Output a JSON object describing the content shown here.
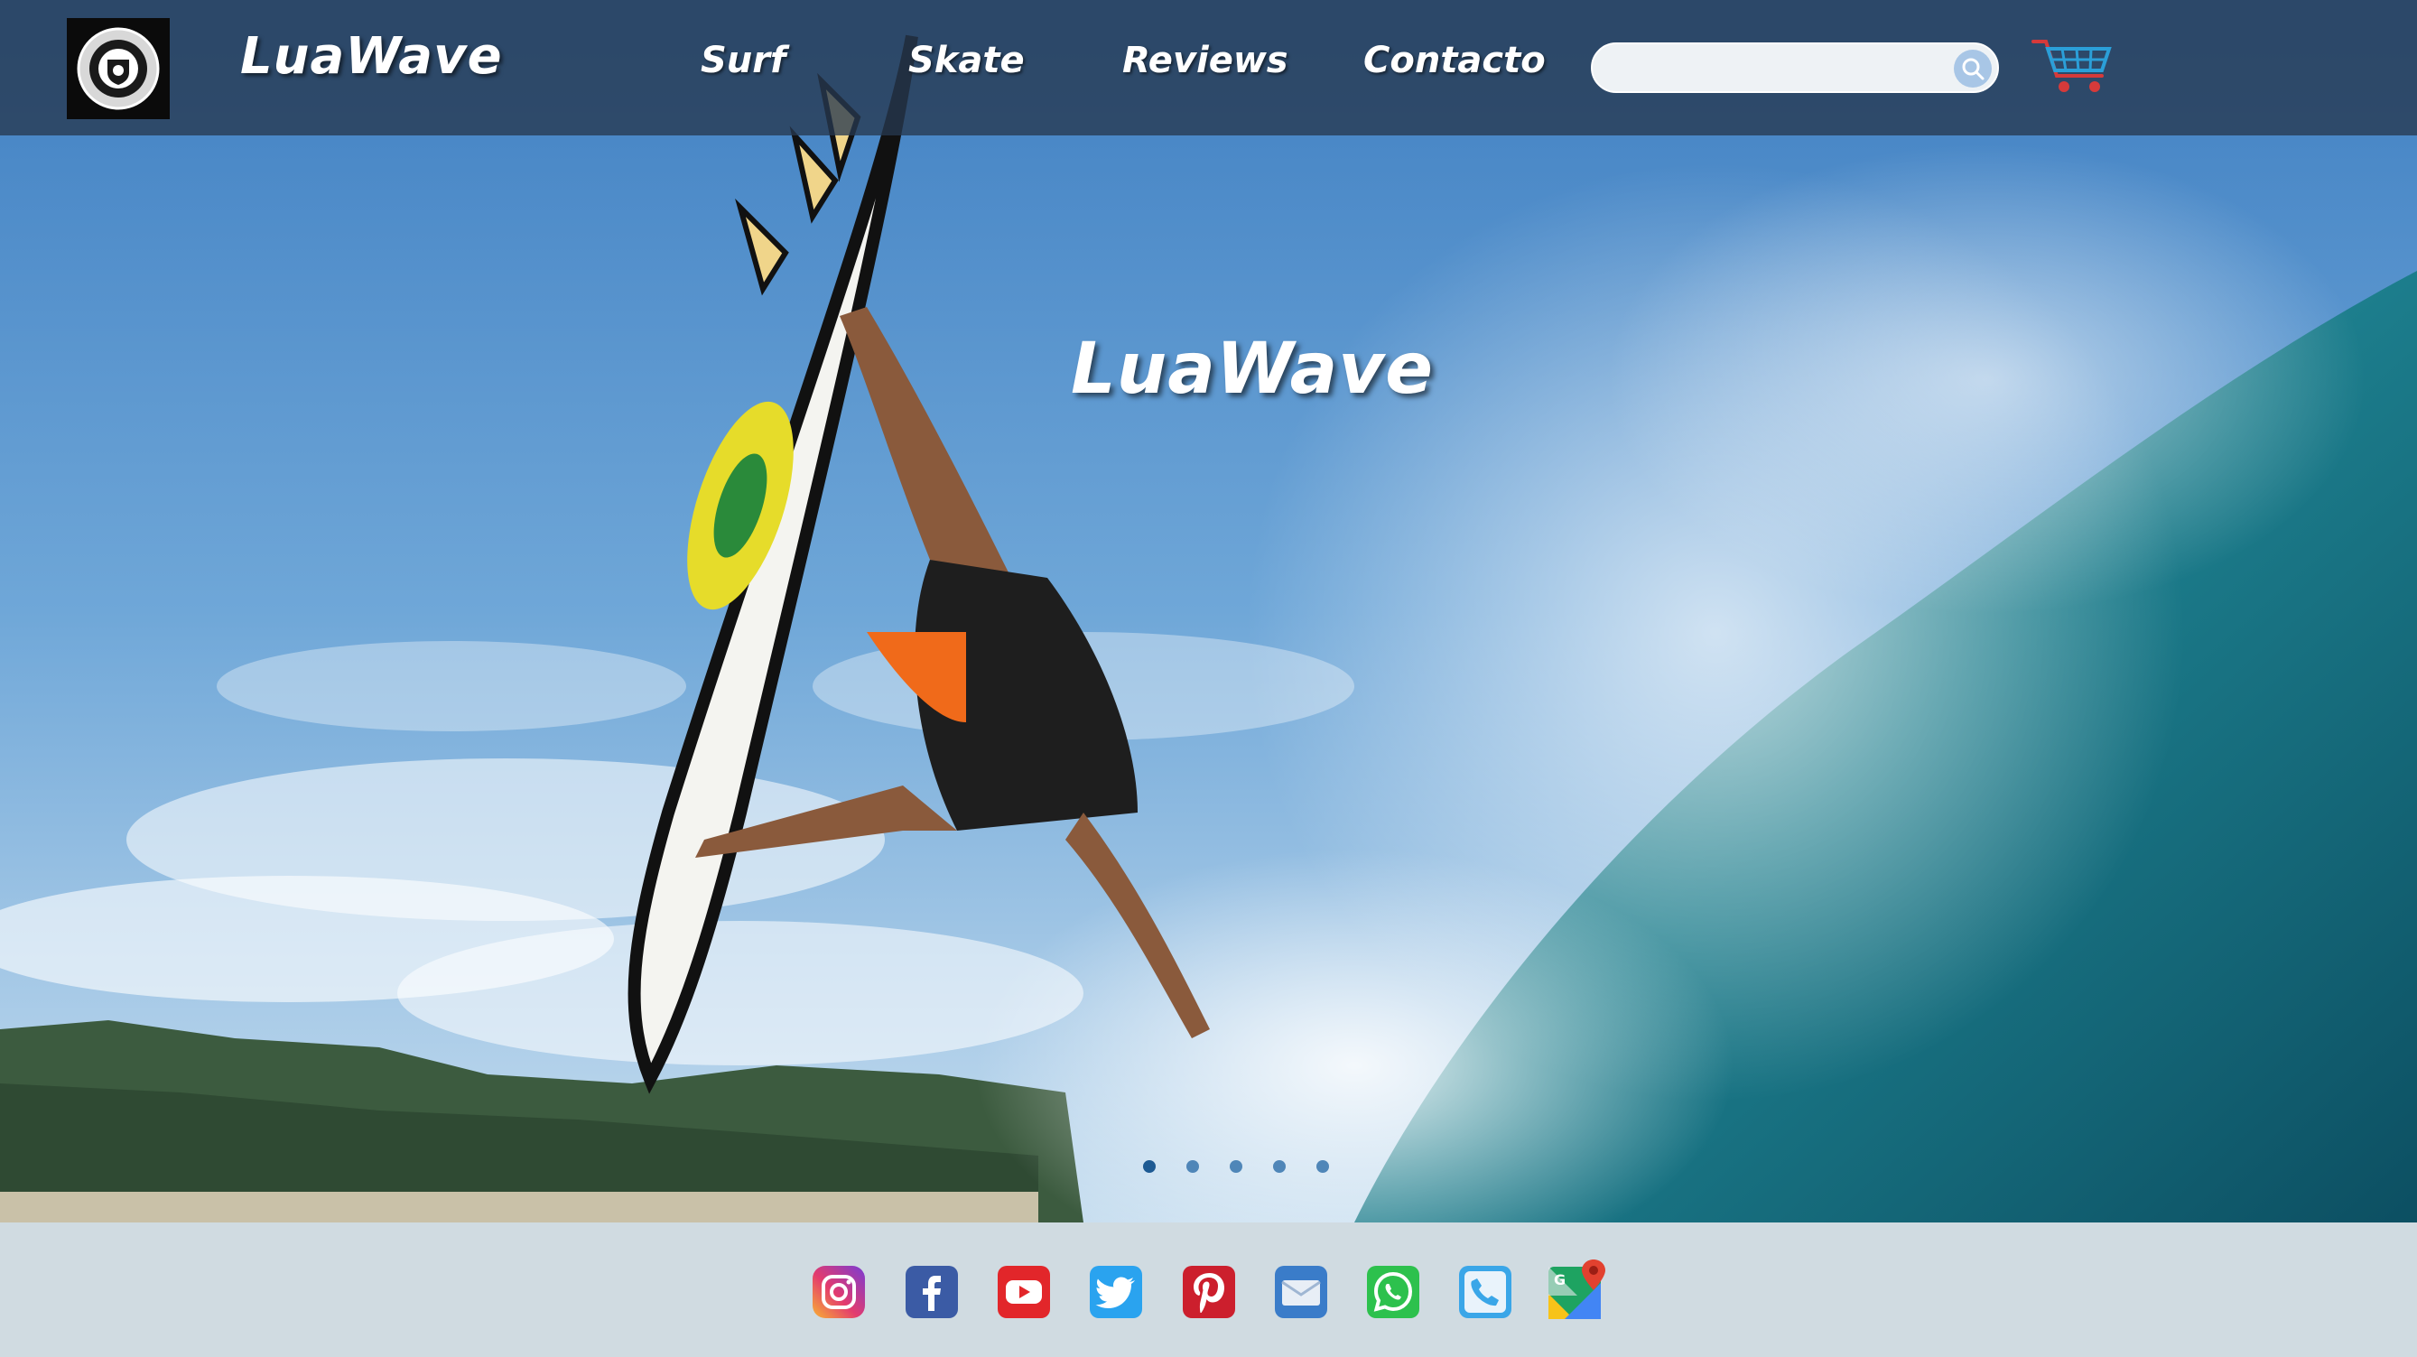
{
  "header": {
    "brand": "LuaWave",
    "nav": [
      {
        "label": "Surf"
      },
      {
        "label": "Skate"
      },
      {
        "label": "Reviews"
      },
      {
        "label": "Contacto"
      }
    ],
    "search": {
      "value": "",
      "placeholder": ""
    }
  },
  "hero": {
    "title": "LuaWave",
    "slide_count": 5,
    "active_slide": 1
  },
  "footer": {
    "social_icons": [
      "instagram-icon",
      "facebook-icon",
      "youtube-icon",
      "twitter-icon",
      "pinterest-icon",
      "email-icon",
      "whatsapp-icon",
      "phone-icon",
      "google-maps-icon"
    ]
  },
  "colors": {
    "header_bg": "#263850",
    "footer_bg": "#d0dbe1",
    "dot": "#4f86b8",
    "accent_cart": "#2b9fd8"
  }
}
